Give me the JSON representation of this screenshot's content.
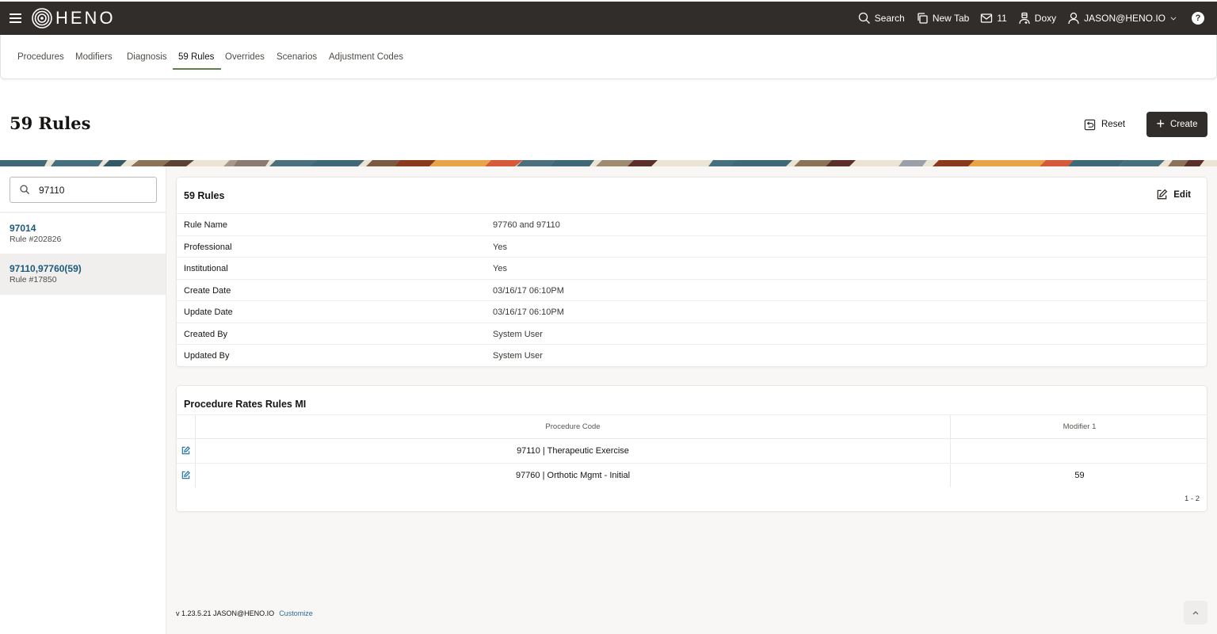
{
  "app": {
    "brand": "HENO",
    "colors": {
      "topbar": "#312d2a",
      "accent": "#5f7d4f",
      "link": "#1d5a7c",
      "edit_icon": "#2b7bb0"
    }
  },
  "topnav": {
    "search_label": "Search",
    "newtab_label": "New Tab",
    "mail_count": "11",
    "doxy_label": "Doxy",
    "user_label": "JASON@HENO.IO",
    "help_label": "?"
  },
  "tabs": [
    {
      "label": "Procedures"
    },
    {
      "label": "Modifiers"
    },
    {
      "label": "Diagnosis"
    },
    {
      "label": "59 Rules",
      "active": true
    },
    {
      "label": "Overrides"
    },
    {
      "label": "Scenarios"
    },
    {
      "label": "Adjustment Codes"
    }
  ],
  "page": {
    "title": "59 Rules",
    "reset_label": "Reset",
    "create_label": "Create"
  },
  "sidebar": {
    "search_value": "97110",
    "search_placeholder": "Search",
    "items": [
      {
        "code": "97014",
        "rule": "Rule #202826",
        "selected": false
      },
      {
        "code": "97110,97760(59)",
        "rule": "Rule #17850",
        "selected": true
      }
    ]
  },
  "details": {
    "title": "59 Rules",
    "edit_label": "Edit",
    "fields": [
      {
        "label": "Rule Name",
        "value": "97760 and 97110"
      },
      {
        "label": "Professional",
        "value": "Yes"
      },
      {
        "label": "Institutional",
        "value": "Yes"
      },
      {
        "label": "Create Date",
        "value": "03/16/17 06:10PM"
      },
      {
        "label": "Update Date",
        "value": "03/16/17 06:10PM"
      },
      {
        "label": "Created By",
        "value": "System User"
      },
      {
        "label": "Updated By",
        "value": "System User"
      }
    ]
  },
  "rates": {
    "title": "Procedure Rates Rules MI",
    "columns": [
      "Procedure Code",
      "Modifier 1"
    ],
    "rows": [
      {
        "procedure": "97110 | Therapeutic Exercise",
        "modifier": ""
      },
      {
        "procedure": "97760 | Orthotic Mgmt - Initial",
        "modifier": "59"
      }
    ],
    "pager": "1 - 2"
  },
  "footer": {
    "version": "v 1.23.5.21 JASON@HENO.IO",
    "customize_label": "Customize"
  }
}
